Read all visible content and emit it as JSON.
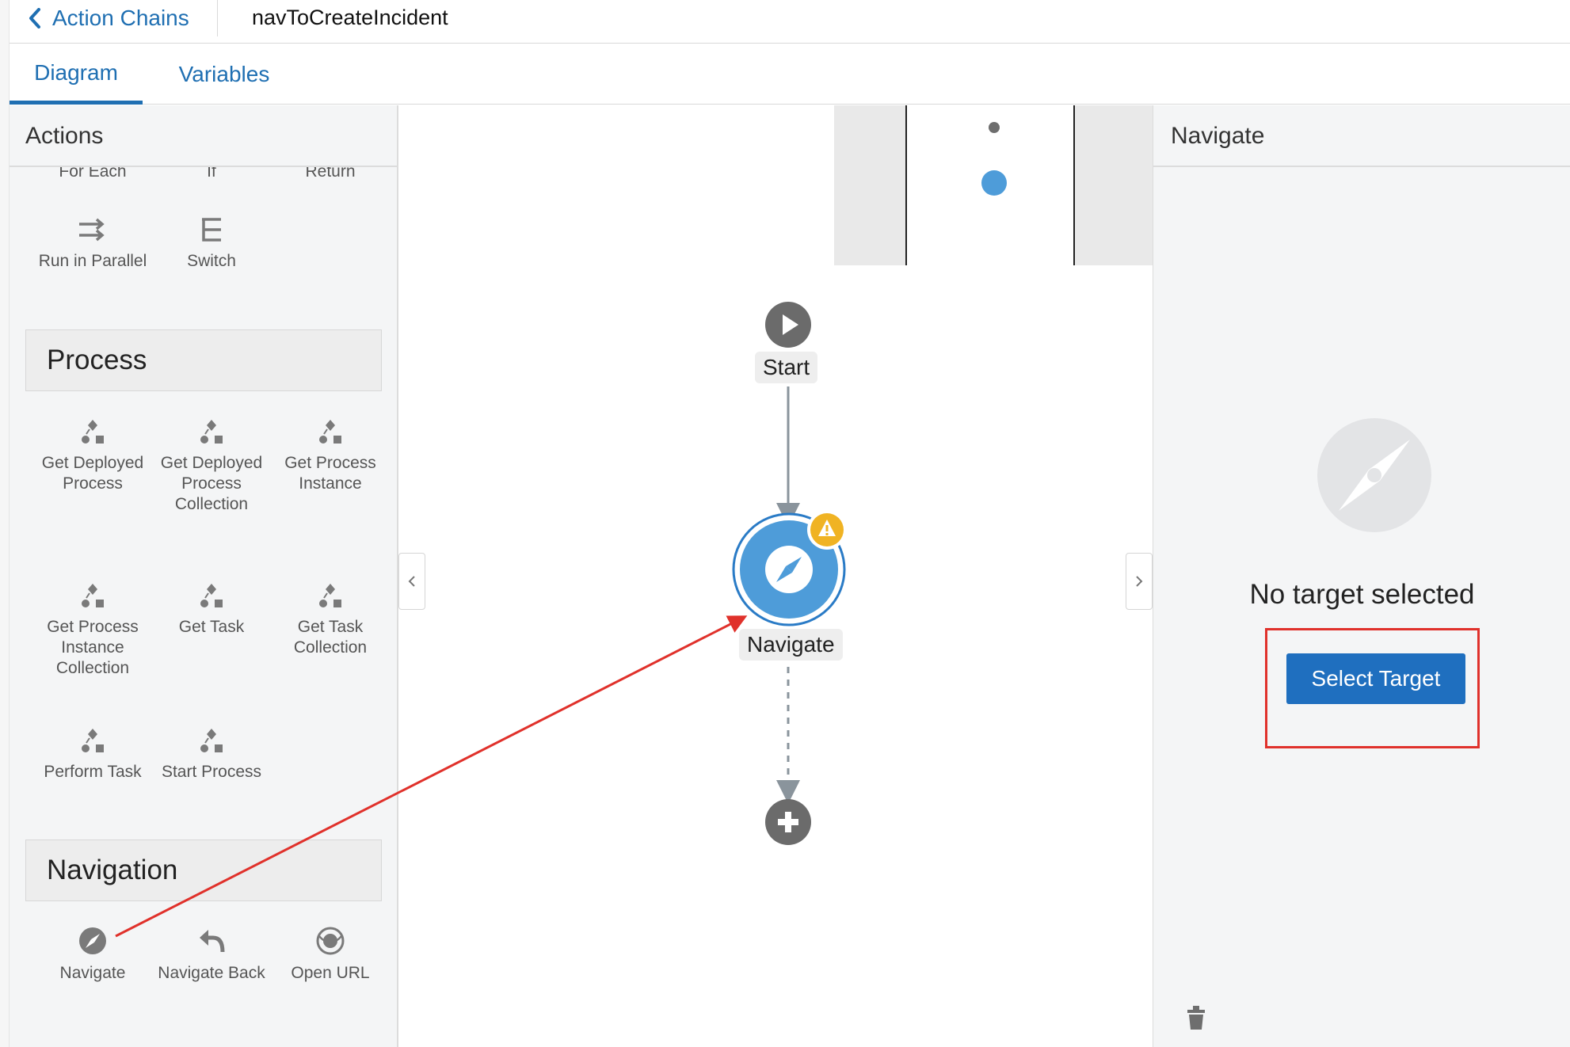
{
  "header": {
    "back_label": "Action Chains",
    "chain_name": "navToCreateIncident"
  },
  "tabs": [
    {
      "label": "Diagram",
      "active": true
    },
    {
      "label": "Variables",
      "active": false
    }
  ],
  "actions_panel": {
    "title": "Actions",
    "partial_items": [
      "For Each",
      "If",
      "Return"
    ],
    "flow_items": [
      "Run in Parallel",
      "Switch"
    ],
    "sections": [
      {
        "title": "Process",
        "items": [
          "Get Deployed Process",
          "Get Deployed Process Collection",
          "Get Process Instance",
          "Get Process Instance Collection",
          "Get Task",
          "Get Task Collection",
          "Perform Task",
          "Start Process"
        ]
      },
      {
        "title": "Navigation",
        "items": [
          "Navigate",
          "Navigate Back",
          "Open URL"
        ]
      }
    ]
  },
  "diagram": {
    "nodes": [
      {
        "label": "Start",
        "icon": "play-icon"
      },
      {
        "label": "Navigate",
        "icon": "compass-icon",
        "warning": true
      },
      {
        "label": "",
        "icon": "plus-icon"
      }
    ]
  },
  "properties_panel": {
    "title": "Navigate",
    "empty_message": "No target selected",
    "select_button": "Select Target",
    "delete_icon": "trash-icon"
  },
  "colors": {
    "link": "#1f6fb2",
    "primary_button": "#1f6fbf",
    "node_blue": "#4e9cd9",
    "warning": "#f0b323",
    "annotation_red": "#e0312b"
  }
}
